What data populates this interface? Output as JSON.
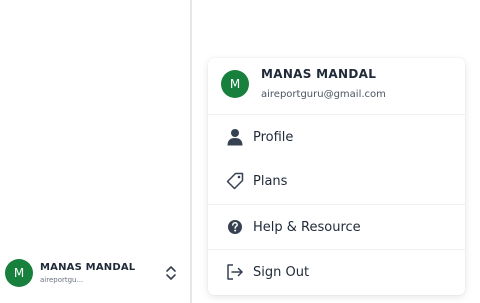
{
  "account": {
    "initial": "M",
    "name": "MANAS MANDAL",
    "email": "aireportguru@gmail.com",
    "email_truncated": "aireportgu...",
    "avatar_color": "#16803c"
  },
  "menu": {
    "items": [
      {
        "label": "Profile",
        "icon": "user-icon"
      },
      {
        "label": "Plans",
        "icon": "tag-icon"
      },
      {
        "label": "Help & Resource",
        "icon": "help-circle-icon"
      },
      {
        "label": "Sign Out",
        "icon": "sign-out-icon"
      }
    ]
  },
  "switcher": {
    "icon": "chevron-up-down-icon"
  }
}
